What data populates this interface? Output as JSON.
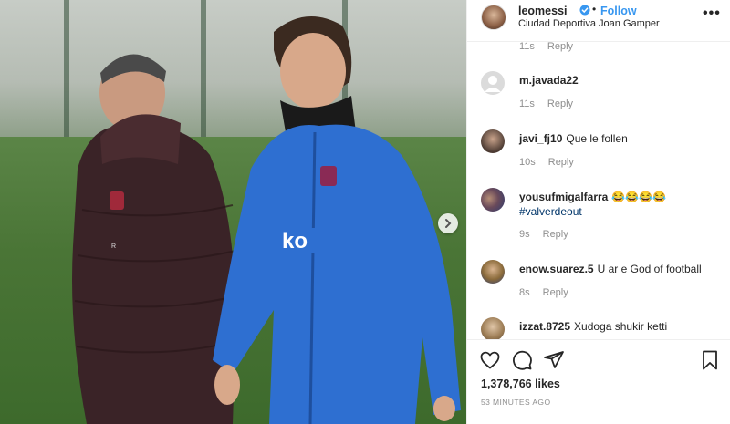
{
  "post": {
    "username": "leomessi",
    "follow_label": "Follow",
    "separator": "•",
    "location": "Ciudad Deportiva Joan Gamper",
    "more_label": "•••",
    "verified_icon": "verified-badge-icon",
    "photo_alt": "Two men in football training gear walking on a pitch"
  },
  "comments": [
    {
      "time": "11s",
      "reply": "Reply"
    },
    {
      "username": "m.javada22",
      "text": "",
      "time": "11s",
      "reply": "Reply"
    },
    {
      "username": "javi_fj10",
      "text": "Que le follen",
      "time": "10s",
      "reply": "Reply"
    },
    {
      "username": "yousufmigalfarra",
      "text": "😂😂😂😂",
      "hashtag": "#valverdeout",
      "time": "9s",
      "reply": "Reply"
    },
    {
      "username": "enow.suarez.5",
      "text": "U ar e God of football",
      "time": "8s",
      "reply": "Reply"
    },
    {
      "username": "izzat.8725",
      "text": "Xudoga shukir ketti"
    }
  ],
  "actions": {
    "likes": "1,378,766 likes",
    "time_ago": "53 MINUTES AGO",
    "icons": [
      "heart-icon",
      "comment-icon",
      "share-icon",
      "bookmark-icon"
    ]
  },
  "colors": {
    "link_blue": "#3897f0",
    "hashtag_blue": "#003569",
    "muted_gray": "#8e8e8e",
    "text_dark": "#262626"
  }
}
